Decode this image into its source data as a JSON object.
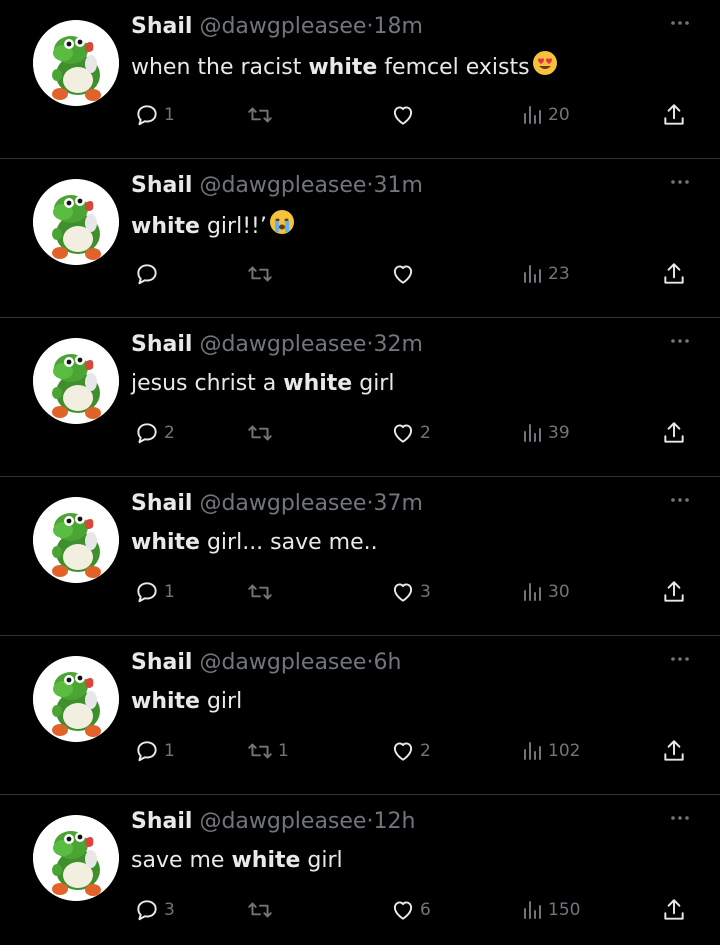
{
  "tweets": [
    {
      "name": "Shail",
      "handle": "@dawgpleasee",
      "dot": "·",
      "time": "18m",
      "text": [
        {
          "t": "when the racist ",
          "b": false
        },
        {
          "t": "white",
          "b": true
        },
        {
          "t": " femcel exists",
          "b": false
        }
      ],
      "emoji": "heart-eyes-emoji",
      "replies": "1",
      "retweets": "",
      "likes": "",
      "views": "20"
    },
    {
      "name": "Shail",
      "handle": "@dawgpleasee",
      "dot": "·",
      "time": "31m",
      "text": [
        {
          "t": "white",
          "b": true
        },
        {
          "t": " girl!!’",
          "b": false
        }
      ],
      "emoji": "crying-emoji",
      "replies": "",
      "retweets": "",
      "likes": "",
      "views": "23"
    },
    {
      "name": "Shail",
      "handle": "@dawgpleasee",
      "dot": "·",
      "time": "32m",
      "text": [
        {
          "t": "jesus christ a ",
          "b": false
        },
        {
          "t": "white",
          "b": true
        },
        {
          "t": " girl",
          "b": false
        }
      ],
      "emoji": "",
      "replies": "2",
      "retweets": "",
      "likes": "2",
      "views": "39"
    },
    {
      "name": "Shail",
      "handle": "@dawgpleasee",
      "dot": "·",
      "time": "37m",
      "text": [
        {
          "t": "white",
          "b": true
        },
        {
          "t": " girl... save me..",
          "b": false
        }
      ],
      "emoji": "",
      "replies": "1",
      "retweets": "",
      "likes": "3",
      "views": "30"
    },
    {
      "name": "Shail",
      "handle": "@dawgpleasee",
      "dot": "·",
      "time": "6h",
      "text": [
        {
          "t": "white",
          "b": true
        },
        {
          "t": " girl",
          "b": false
        }
      ],
      "emoji": "",
      "replies": "1",
      "retweets": "1",
      "likes": "2",
      "views": "102"
    },
    {
      "name": "Shail",
      "handle": "@dawgpleasee",
      "dot": "·",
      "time": "12h",
      "text": [
        {
          "t": "save me ",
          "b": false
        },
        {
          "t": "white",
          "b": true
        },
        {
          "t": " girl",
          "b": false
        }
      ],
      "emoji": "",
      "replies": "3",
      "retweets": "",
      "likes": "6",
      "views": "150"
    }
  ],
  "icons": {
    "avatar": "green-dinosaur-avatar",
    "reply": "reply-icon",
    "retweet": "retweet-icon",
    "like": "heart-icon",
    "views": "views-icon",
    "share": "share-icon",
    "more": "more-icon"
  },
  "colors": {
    "background": "#000000",
    "text": "#e7e9ea",
    "muted": "#71767b",
    "divider": "#2f3336"
  }
}
